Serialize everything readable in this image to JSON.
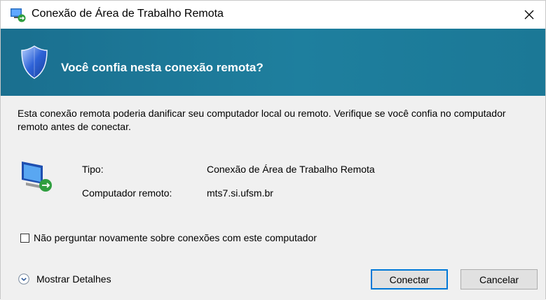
{
  "window": {
    "title": "Conexão de Área de Trabalho Remota",
    "close_glyph": "✕"
  },
  "banner": {
    "heading": "Você confia nesta conexão remota?"
  },
  "body": {
    "description": "Esta conexão remota poderia danificar seu computador local ou remoto. Verifique se você confia no computador remoto antes de conectar.",
    "type_label": "Tipo:",
    "type_value": "Conexão de Área de Trabalho Remota",
    "remote_label": "Computador remoto:",
    "remote_value": "mts7.si.ufsm.br",
    "checkbox_label": "Não perguntar novamente sobre conexões com este computador",
    "checkbox_checked": false
  },
  "footer": {
    "details_label": "Mostrar Detalhes",
    "connect_label": "Conectar",
    "cancel_label": "Cancelar"
  },
  "colors": {
    "banner": "#1e7f9e",
    "default_button_border": "#0078d7"
  }
}
